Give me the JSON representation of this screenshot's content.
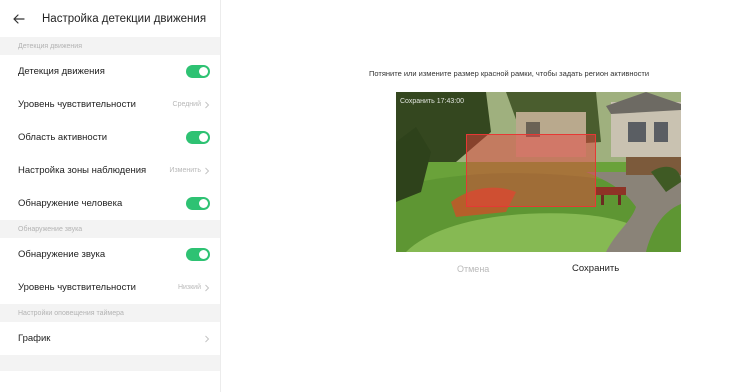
{
  "header": {
    "title": "Настройка детекции движения"
  },
  "sections": {
    "motion": {
      "title": "Детекция движения",
      "motion_detection": "Детекция движения",
      "sensitivity_label": "Уровень чувствительности",
      "sensitivity_value": "Средний",
      "activity_area": "Область активности",
      "zone_setup_label": "Настройка зоны наблюдения",
      "zone_setup_value": "Изменить",
      "human_detection": "Обнаружение человека"
    },
    "sound": {
      "title": "Обнаружение звука",
      "sound_detection": "Обнаружение звука",
      "sensitivity_label": "Уровень чувствительности",
      "sensitivity_value": "Низкий"
    },
    "schedule": {
      "title": "Настройки оповещения таймера",
      "schedule_label": "График"
    }
  },
  "toggles": {
    "motion_detection": true,
    "activity_area": true,
    "human_detection": true,
    "sound_detection": true
  },
  "editor": {
    "instruction": "Потяните или измените размер красной рамки, чтобы задать регион активности",
    "timestamp": "Сохранить 17:43:00",
    "cancel": "Отмена",
    "save": "Сохранить"
  },
  "colors": {
    "toggle_on": "#2ec273",
    "region": "#e53935"
  },
  "icons": {
    "back": "back-arrow-icon",
    "chevron": "chevron-right-icon"
  }
}
